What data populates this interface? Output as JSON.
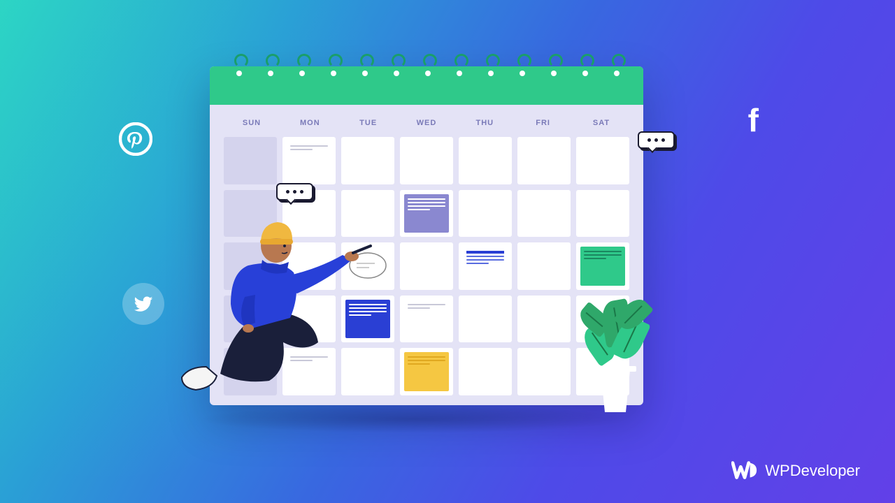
{
  "days": [
    "SUN",
    "MON",
    "TUE",
    "WED",
    "THU",
    "FRI",
    "SAT"
  ],
  "brand": "WPDeveloper",
  "icons": {
    "pinterest": "pinterest-icon",
    "twitter": "twitter-icon",
    "facebook": "facebook-icon"
  },
  "colors": {
    "teal": "#2fc98a",
    "blue": "#2a3fd4",
    "purple": "#8a88d0",
    "yellow": "#f5c742"
  }
}
